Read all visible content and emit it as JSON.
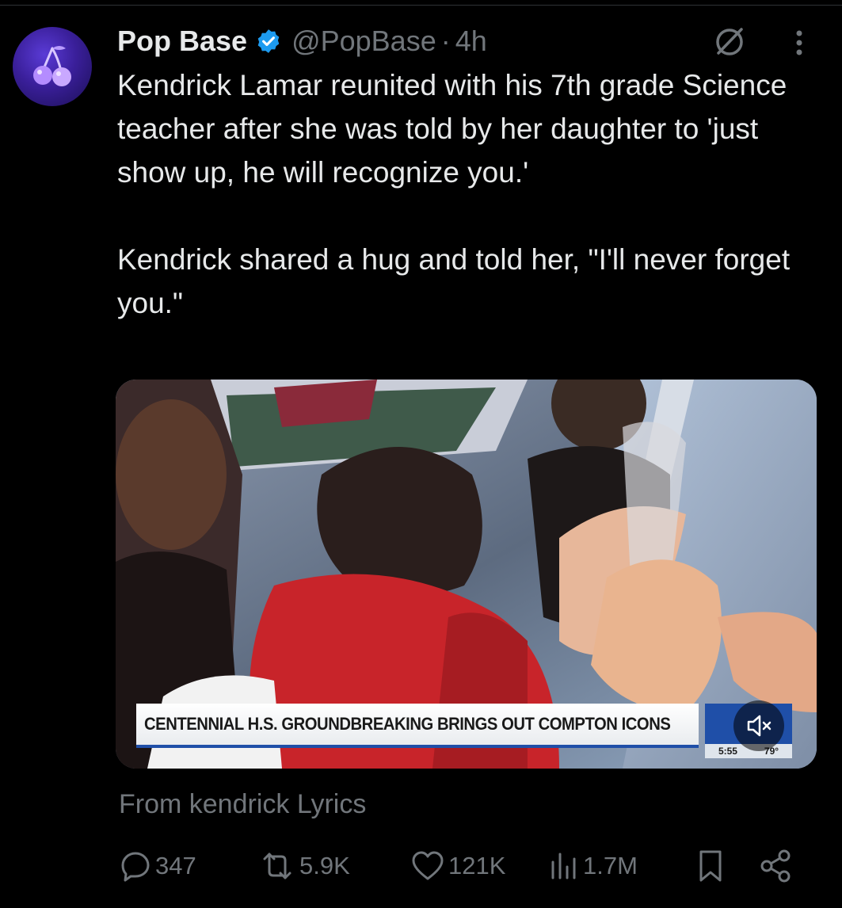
{
  "tweet": {
    "display_name": "Pop Base",
    "handle": "@PopBase",
    "separator": "·",
    "time": "4h",
    "text_paragraph_1": "Kendrick Lamar reunited with his 7th grade Science teacher after she was told by her daughter to 'just show up, he will recognize you.'",
    "text_paragraph_2": "Kendrick shared a hug and told her, \"I'll never forget you.\"",
    "source": "From kendrick Lyrics"
  },
  "media": {
    "chyron": "CENTENNIAL H.S. GROUNDBREAKING BRINGS OUT COMPTON ICONS",
    "clock_time": "5:55",
    "temperature": "79°"
  },
  "actions": {
    "replies": "347",
    "reposts": "5.9K",
    "likes": "121K",
    "views": "1.7M"
  },
  "icons": {
    "verified": "verified-badge-icon",
    "grok": "grok-icon",
    "more": "more-options-icon",
    "mute": "mute-icon",
    "reply": "reply-icon",
    "repost": "repost-icon",
    "like": "heart-icon",
    "views": "views-chart-icon",
    "bookmark": "bookmark-icon",
    "share": "share-icon"
  },
  "colors": {
    "background": "#000000",
    "text": "#e7e9ea",
    "secondary_text": "#71767b",
    "verified_blue": "#1d9bf0",
    "avatar_purple": "#3a1f9a"
  }
}
